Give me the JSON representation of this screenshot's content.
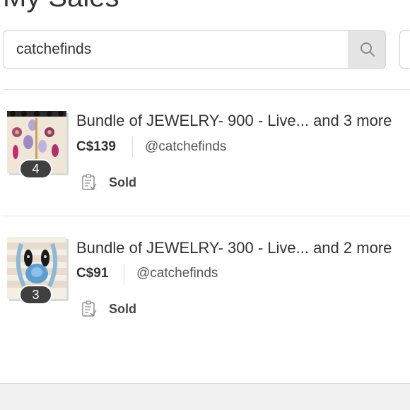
{
  "page": {
    "title": "My Sales"
  },
  "search": {
    "value": "catchefinds",
    "placeholder": ""
  },
  "items": [
    {
      "title": "Bundle of JEWELRY- 900 - Live... and 3 more",
      "price": "C$139",
      "seller": "@catchefinds",
      "item_count": "4",
      "status": "Sold"
    },
    {
      "title": "Bundle of JEWELRY- 300 - Live... and 2 more",
      "price": "C$91",
      "seller": "@catchefinds",
      "item_count": "3",
      "status": "Sold"
    }
  ],
  "icons": {
    "search": "search-icon",
    "status": "clipboard-check-icon"
  },
  "colors": {
    "text": "#333333",
    "badge": "#3f3f3f",
    "search_button_bg": "#e5e5e5"
  }
}
